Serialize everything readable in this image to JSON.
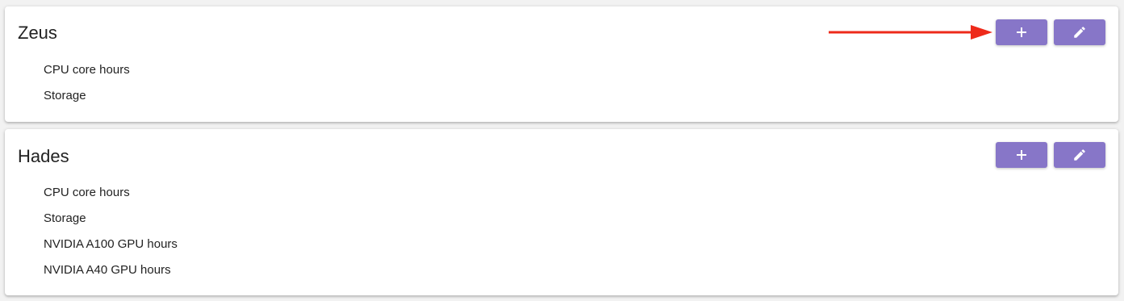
{
  "accent_color": "#8776c8",
  "annotation_color": "#ee2a1a",
  "groups": [
    {
      "name": "Zeus",
      "resources": [
        "CPU core hours",
        "Storage"
      ],
      "add_icon": "plus-icon",
      "edit_icon": "pencil-icon"
    },
    {
      "name": "Hades",
      "resources": [
        "CPU core hours",
        "Storage",
        "NVIDIA A100 GPU hours",
        "NVIDIA A40 GPU hours"
      ],
      "add_icon": "plus-icon",
      "edit_icon": "pencil-icon"
    }
  ]
}
